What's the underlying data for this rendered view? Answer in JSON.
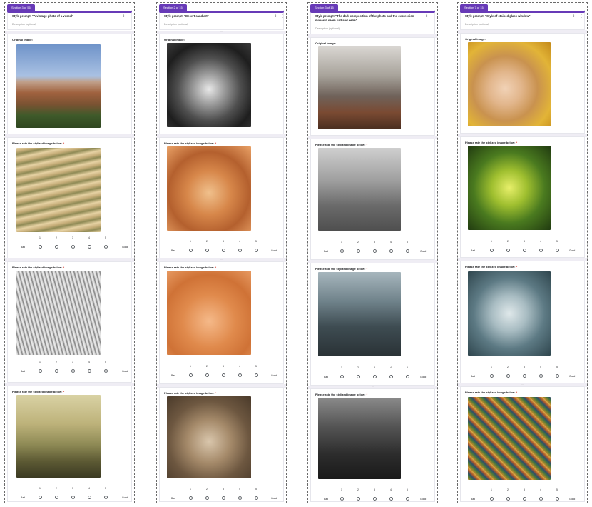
{
  "colors": {
    "accent": "#673ab7",
    "required": "#d93025",
    "page_gap": "#efedf4"
  },
  "common": {
    "description_placeholder": "Description (optional)",
    "original_label": "Original image:",
    "rate_label": "Please rate the stylized image below:",
    "required_mark": " *",
    "bad_label": "Bad",
    "good_label": "Good",
    "scale": [
      "1",
      "2",
      "3",
      "4",
      "5"
    ]
  },
  "panels": [
    {
      "section_badge": "Section 3 of 56",
      "style_prompt": "Style prompt: \"A vintage photo of a vessel\"",
      "original_image": "rock-formation-under-blue-sky",
      "stylized_images": [
        "wavy-tan-pencil-rock",
        "grey-pencil-sketch-rock",
        "sepia-fragmented-rock"
      ]
    },
    {
      "section_badge": "Section 2 of 15",
      "style_prompt": "Style prompt: \"Desert sand art\"",
      "original_image": "black-and-white-lion-portrait",
      "stylized_images": [
        "orange-textured-lion",
        "orange-sand-lion",
        "sepia-sketch-lion"
      ]
    },
    {
      "section_badge": "Section 3 of 15",
      "style_prompt": "Style prompt: \"The dark composition of the photo and the expression makes it seem sad and eerie\"",
      "original_image": "foggy-forest-autumn-path",
      "stylized_images": [
        "grey-misty-forest",
        "blue-forest-with-faces",
        "dark-monochrome-forest"
      ]
    },
    {
      "section_badge": "Section 7 of 15",
      "style_prompt": "Style prompt: \"Style of stained glass window\"",
      "original_image": "blonde-woman-portrait",
      "stylized_images": [
        "green-yellow-stained-glass-portrait",
        "blue-grey-sketch-portrait",
        "multicolor-mosaic-portrait"
      ]
    }
  ]
}
